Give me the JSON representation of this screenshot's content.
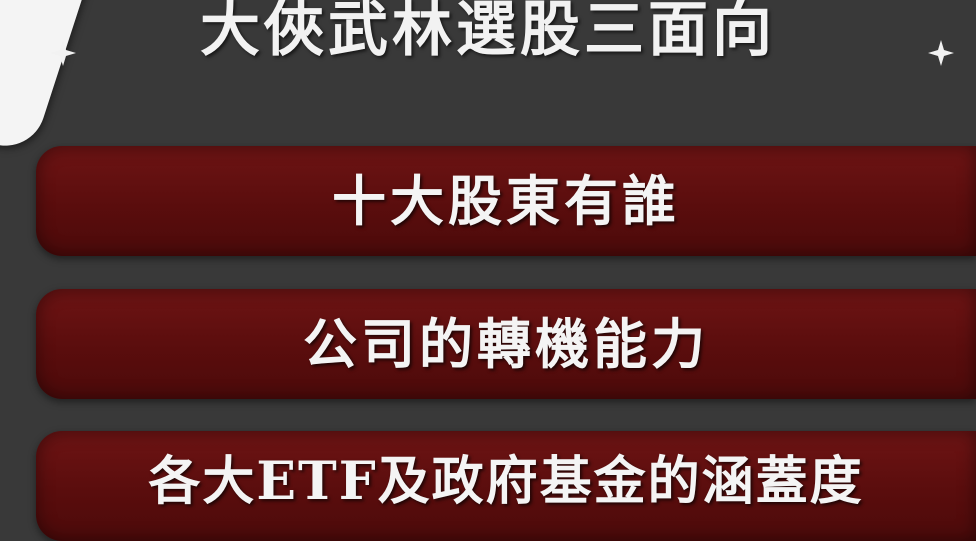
{
  "header": {
    "title": "大俠武林選股三面向",
    "left_icon": "sparkle-icon",
    "right_icon": "sparkle-icon"
  },
  "items": [
    {
      "label": "十大股東有誰"
    },
    {
      "label": "公司的轉機能力"
    },
    {
      "label": "各大ETF及政府基金的涵蓋度"
    }
  ],
  "colors": {
    "background": "#393939",
    "pill": "#5a0d0d",
    "text": "#f2f2f2"
  }
}
